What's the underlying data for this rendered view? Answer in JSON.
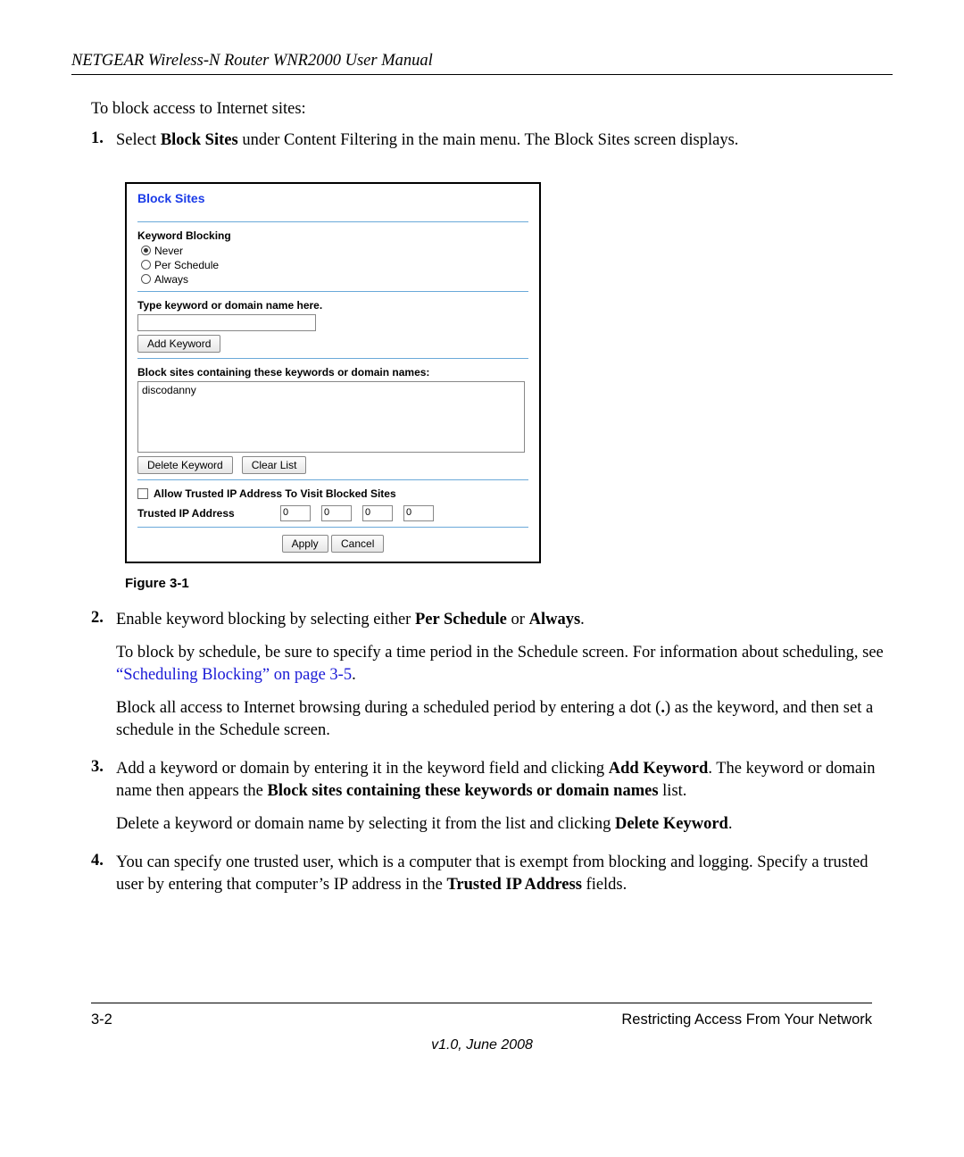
{
  "header": {
    "title": "NETGEAR Wireless-N Router WNR2000 User Manual"
  },
  "intro": "To block access to Internet sites:",
  "steps": {
    "s1_num": "1.",
    "s1_a": "Select ",
    "s1_b": "Block Sites",
    "s1_c": " under Content Filtering in the main menu. The Block Sites screen displays.",
    "s2_num": "2.",
    "s2_a": "Enable keyword blocking by selecting either ",
    "s2_b": "Per Schedule",
    "s2_c": " or ",
    "s2_d": "Always",
    "s2_e": ".",
    "s2_p2a": "To block by schedule, be sure to specify a time period in the Schedule screen. For information about scheduling, see ",
    "s2_link": "“Scheduling Blocking” on page 3-5",
    "s2_p2b": ".",
    "s2_p3a": "Block all access to Internet browsing during a scheduled period by entering a dot (",
    "s2_p3dot": ".",
    "s2_p3b": ") as the keyword, and then set a schedule in the Schedule screen.",
    "s3_num": "3.",
    "s3_a": "Add a keyword or domain by entering it in the keyword field and clicking ",
    "s3_b": "Add Keyword",
    "s3_c": ". The keyword or domain name then appears the ",
    "s3_d": "Block sites containing these keywords or domain names",
    "s3_e": " list.",
    "s3_p2a": "Delete a keyword or domain name by selecting it from the list and clicking ",
    "s3_p2b": "Delete Keyword",
    "s3_p2c": ".",
    "s4_num": "4.",
    "s4_a": "You can specify one trusted user, which is a computer that is exempt from blocking and logging. Specify a trusted user by entering that computer’s IP address in the ",
    "s4_b": "Trusted IP Address",
    "s4_c": " fields."
  },
  "figure": {
    "caption": "Figure 3-1"
  },
  "shot": {
    "title": "Block Sites",
    "kb_heading": "Keyword Blocking",
    "radio_never": "Never",
    "radio_per": "Per Schedule",
    "radio_always": "Always",
    "type_label": "Type keyword or domain name here.",
    "add_btn": "Add Keyword",
    "list_label": "Block sites containing these keywords or domain names:",
    "list_item": "discodanny",
    "del_btn": "Delete Keyword",
    "clear_btn": "Clear List",
    "allow_label": "Allow Trusted IP Address To Visit Blocked Sites",
    "trusted_label": "Trusted IP Address",
    "ip": [
      "0",
      "0",
      "0",
      "0"
    ],
    "apply": "Apply",
    "cancel": "Cancel"
  },
  "footer": {
    "page": "3-2",
    "section": "Restricting Access From Your Network",
    "version": "v1.0, June 2008"
  }
}
